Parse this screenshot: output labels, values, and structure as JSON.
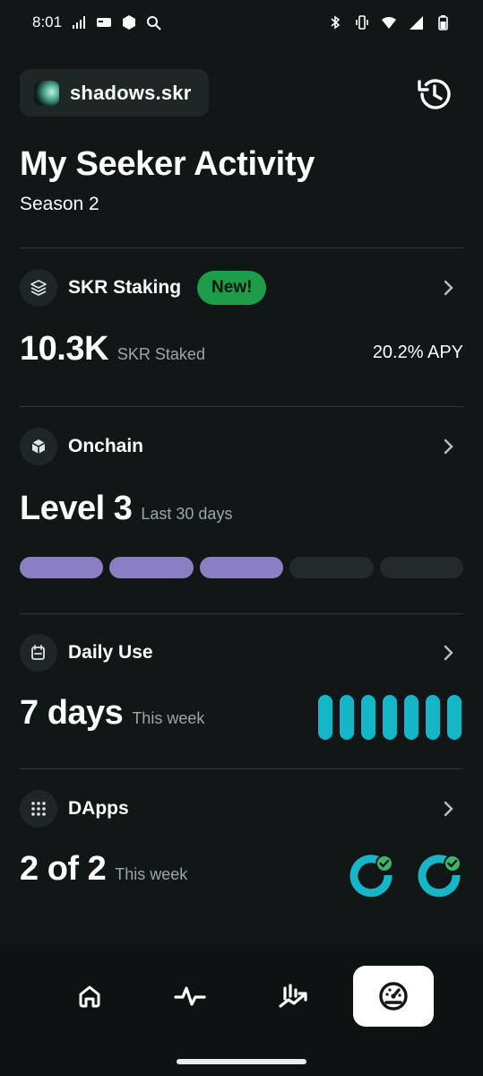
{
  "status_bar": {
    "time": "8:01"
  },
  "account": {
    "name": "shadows.skr"
  },
  "header": {
    "title": "My Seeker Activity",
    "subtitle": "Season 2"
  },
  "staking": {
    "label": "SKR Staking",
    "badge": "New!",
    "value": "10.3K",
    "value_caption": "SKR Staked",
    "apy": "20.2% APY"
  },
  "onchain": {
    "label": "Onchain",
    "value": "Level 3",
    "value_caption": "Last 30 days",
    "level_filled": 3,
    "level_total": 5
  },
  "daily_use": {
    "label": "Daily Use",
    "value": "7 days",
    "value_caption": "This week",
    "days_active": 7,
    "days_total": 7
  },
  "dapps": {
    "label": "DApps",
    "value": "2 of 2",
    "value_caption": "This week",
    "completed": 2
  },
  "colors": {
    "background": "#101716",
    "badge_green": "#1d9c4a",
    "level_purple": "#8b7fc1",
    "daily_cyan": "#16b6c9",
    "check_green": "#3fb36a"
  },
  "nav": {
    "items": [
      {
        "icon": "home-icon",
        "active": false
      },
      {
        "icon": "activity-icon",
        "active": false
      },
      {
        "icon": "chart-trend-icon",
        "active": false
      },
      {
        "icon": "gauge-icon",
        "active": true
      }
    ]
  }
}
